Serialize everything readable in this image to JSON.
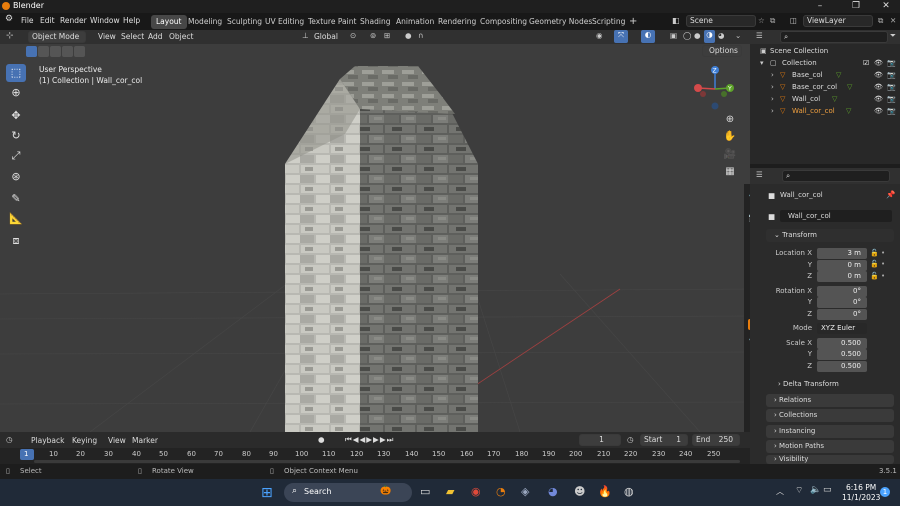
{
  "app": {
    "title": "Blender",
    "version": "3.5.1"
  },
  "menu": [
    "File",
    "Edit",
    "Render",
    "Window",
    "Help"
  ],
  "workspaces": [
    "Layout",
    "Modeling",
    "Sculpting",
    "UV Editing",
    "Texture Paint",
    "Shading",
    "Animation",
    "Rendering",
    "Compositing",
    "Geometry Nodes",
    "Scripting"
  ],
  "active_workspace": "Layout",
  "scene": {
    "name": "Scene",
    "view_layer": "ViewLayer"
  },
  "viewport": {
    "mode": "Object Mode",
    "menus": [
      "View",
      "Select",
      "Add",
      "Object"
    ],
    "orientation": "Global",
    "options_label": "Options",
    "perspective": "User Perspective",
    "context": "(1) Collection | Wall_cor_col"
  },
  "outliner": {
    "root": "Scene Collection",
    "collection": "Collection",
    "objects": [
      "Base_col",
      "Base_cor_col",
      "Wall_col",
      "Wall_cor_col"
    ],
    "selected": "Wall_cor_col"
  },
  "properties": {
    "object_name": "Wall_cor_col",
    "data_name": "Wall_cor_col",
    "transform_label": "Transform",
    "location_label": "Location X",
    "location": [
      "3 m",
      "0 m",
      "0 m"
    ],
    "rotation_label": "Rotation X",
    "rotation": [
      "0°",
      "0°",
      "0°"
    ],
    "mode_label": "Mode",
    "mode_value": "XYZ Euler",
    "scale_label": "Scale X",
    "scale": [
      "0.500",
      "0.500",
      "0.500"
    ],
    "axis_y": "Y",
    "axis_z": "Z",
    "delta": "Delta Transform",
    "panels": [
      "Relations",
      "Collections",
      "Instancing",
      "Motion Paths",
      "Visibility"
    ]
  },
  "timeline": {
    "menus": [
      "Playback",
      "Keying",
      "View",
      "Marker"
    ],
    "current_frame": "1",
    "start_label": "Start",
    "start": "1",
    "end_label": "End",
    "end": "250",
    "ticks": [
      "1",
      "10",
      "20",
      "30",
      "40",
      "50",
      "60",
      "70",
      "80",
      "90",
      "100",
      "110",
      "120",
      "130",
      "140",
      "150",
      "160",
      "170",
      "180",
      "190",
      "200",
      "210",
      "220",
      "230",
      "240",
      "250"
    ]
  },
  "status": {
    "select": "Select",
    "rotate": "Rotate View",
    "context_menu": "Object Context Menu"
  },
  "taskbar": {
    "search": "Search",
    "time": "6:16 PM",
    "date": "11/1/2023",
    "notif": "1"
  },
  "colors": {
    "accent": "#4772b3",
    "orange": "#e87d0d"
  }
}
